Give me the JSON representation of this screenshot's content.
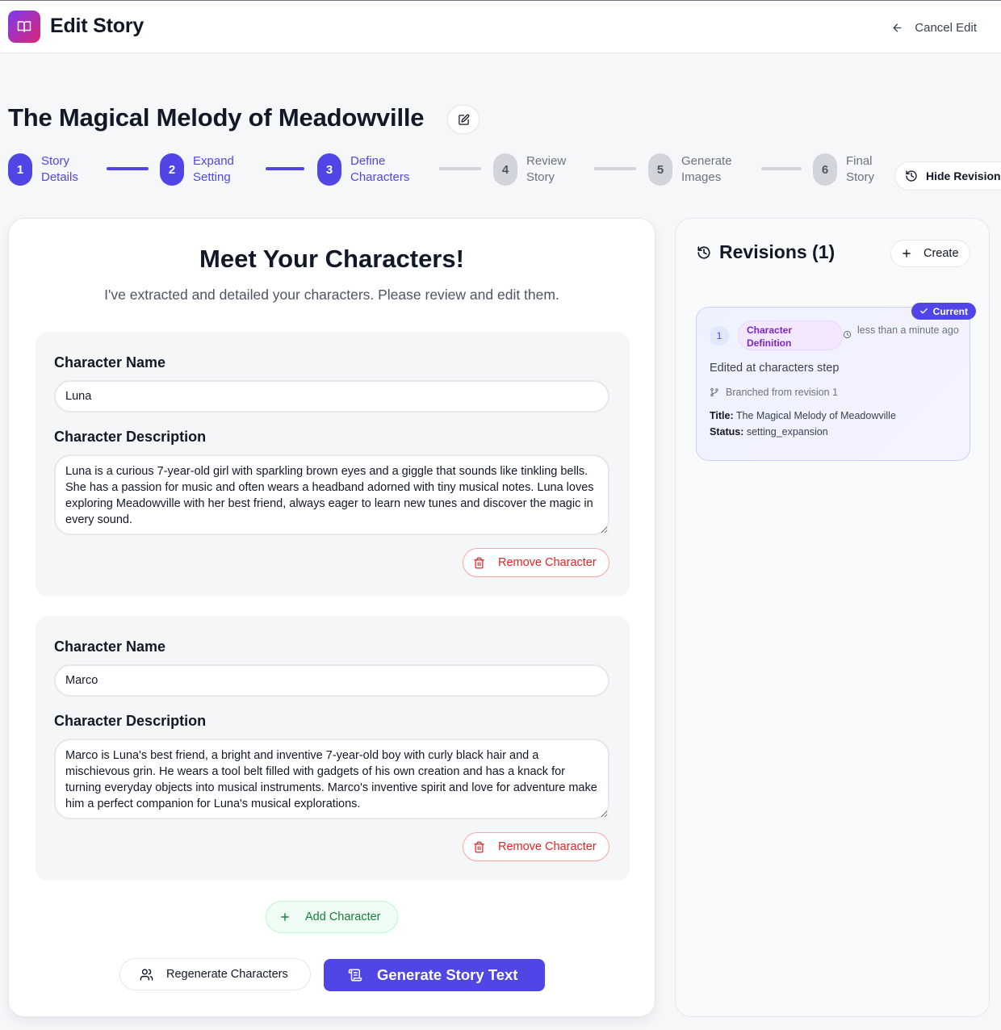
{
  "header": {
    "title": "Edit Story",
    "cancel_label": "Cancel Edit",
    "logo_icon": "book-open-icon"
  },
  "story": {
    "title": "The Magical Melody of Meadowville"
  },
  "stepper": {
    "steps": [
      {
        "number": "1",
        "line1": "Story",
        "line2": "Details",
        "state": "done"
      },
      {
        "number": "2",
        "line1": "Expand",
        "line2": "Setting",
        "state": "done"
      },
      {
        "number": "3",
        "line1": "Define",
        "line2": "Characters",
        "state": "done"
      },
      {
        "number": "4",
        "line1": "Review",
        "line2": "Story",
        "state": "todo"
      },
      {
        "number": "5",
        "line1": "Generate",
        "line2": "Images",
        "state": "todo"
      },
      {
        "number": "6",
        "line1": "Final",
        "line2": "Story",
        "state": "todo"
      }
    ],
    "hide_revisions_label": "Hide Revisions"
  },
  "main": {
    "heading": "Meet Your Characters!",
    "subheading": "I've extracted and detailed your characters. Please review and edit them.",
    "name_label": "Character Name",
    "description_label": "Character Description",
    "remove_label": "Remove Character",
    "characters": [
      {
        "name": "Luna",
        "description": "Luna is a curious 7-year-old girl with sparkling brown eyes and a giggle that sounds like tinkling bells. She has a passion for music and often wears a headband adorned with tiny musical notes. Luna loves exploring Meadowville with her best friend, always eager to learn new tunes and discover the magic in every sound."
      },
      {
        "name": "Marco",
        "description": "Marco is Luna's best friend, a bright and inventive 7-year-old boy with curly black hair and a mischievous grin. He wears a tool belt filled with gadgets of his own creation and has a knack for turning everyday objects into musical instruments. Marco's inventive spirit and love for adventure make him a perfect companion for Luna's musical explorations."
      }
    ],
    "add_label": "Add Character",
    "regenerate_label": "Regenerate Characters",
    "generate_label": "Generate Story Text"
  },
  "revisions": {
    "title": "Revisions (1)",
    "create_label": "Create",
    "items": [
      {
        "number": "1",
        "badge": "Current",
        "type": "Character Definition",
        "time": "less than a minute ago",
        "description": "Edited at characters step",
        "branch": "Branched from revision 1",
        "title_label": "Title:",
        "title_value": "The Magical Melody of Meadowville",
        "status_label": "Status:",
        "status_value": "setting_expansion"
      }
    ]
  },
  "colors": {
    "primary": "#4f46e5",
    "danger": "#dc2626",
    "success": "#15803d",
    "badge_purple": "#7e22ce"
  }
}
